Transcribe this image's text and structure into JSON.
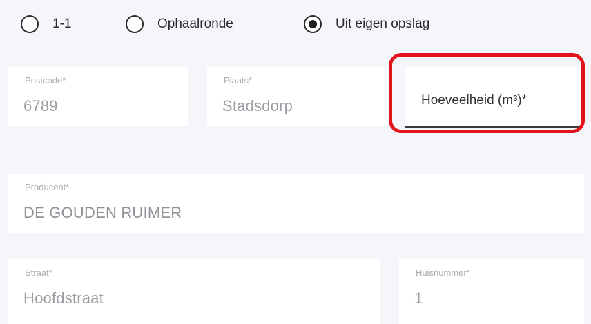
{
  "source_type": {
    "options": [
      {
        "label": "1-1",
        "selected": false
      },
      {
        "label": "Ophaalronde",
        "selected": false
      },
      {
        "label": "Uit eigen opslag",
        "selected": true
      }
    ]
  },
  "fields": {
    "postcode": {
      "label": "Postcode*",
      "value": "6789"
    },
    "plaats": {
      "label": "Plaats*",
      "value": "Stadsdorp"
    },
    "hoeveelheid": {
      "placeholder": "Hoeveelheid (m³)*",
      "value": ""
    },
    "producent": {
      "label": "Producent*",
      "value": "DE GOUDEN RUIMER"
    },
    "straat": {
      "label": "Straat*",
      "value": "Hoofdstraat"
    },
    "huisnummer": {
      "label": "Huisnummer*",
      "value": "1"
    }
  },
  "colors": {
    "highlight": "#e3131b",
    "background": "#f4f6f9",
    "field_background": "#ffffff"
  }
}
